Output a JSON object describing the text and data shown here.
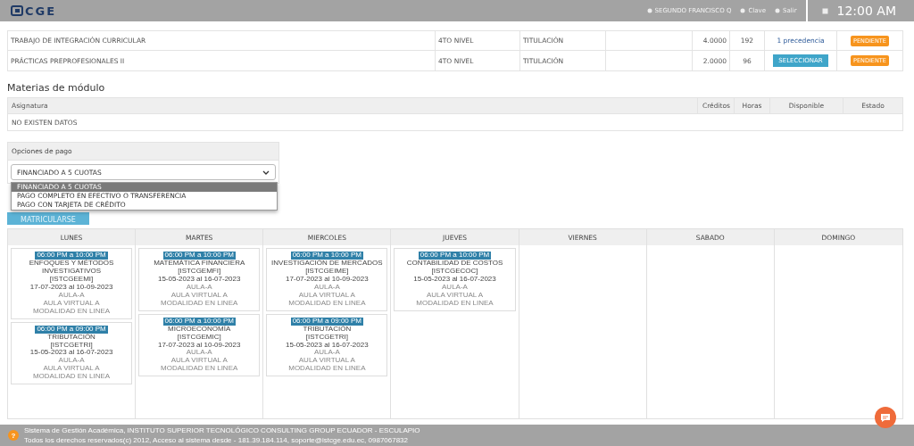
{
  "header": {
    "logo": "CGE",
    "user": "SEGUNDO FRANCISCO Q",
    "links": [
      "Clave",
      "Salir"
    ],
    "time": "12:00 AM"
  },
  "subjects": [
    {
      "name": "TRABAJO DE INTEGRACIÓN CURRICULAR",
      "level": "4TO NIVEL",
      "type": "TITULACIÓN",
      "credits": "4.0000",
      "hours": "192",
      "available": {
        "kind": "text",
        "label": "1 precedencia"
      },
      "status": "PENDIENTE"
    },
    {
      "name": "PRÁCTICAS PREPROFESIONALES II",
      "level": "4TO NIVEL",
      "type": "TITULACIÓN",
      "credits": "2.0000",
      "hours": "96",
      "available": {
        "kind": "button",
        "label": "SELECCIONAR"
      },
      "status": "PENDIENTE"
    }
  ],
  "module": {
    "title": "Materias de módulo",
    "columns": [
      "Asignatura",
      "Créditos",
      "Horas",
      "Disponible",
      "Estado"
    ],
    "empty": "NO EXISTEN DATOS"
  },
  "payment": {
    "title": "Opciones de pago",
    "value": "FINANCIADO A 5 CUOTAS",
    "options": [
      {
        "label": "FINANCIADO A 5 CUOTAS",
        "selected": true
      },
      {
        "label": "PAGO COMPLETO EN EFECTIVO O TRANSFERENCIA",
        "selected": false
      },
      {
        "label": "PAGO CON TARJETA DE CRÉDITO",
        "selected": false
      }
    ],
    "button": "MATRICULARSE"
  },
  "schedule": [
    {
      "day": "LUNES",
      "classes": [
        {
          "time": "06:00 PM a 10:00 PM",
          "name": "ENFOQUES Y MÉTODOS INVESTIGATIVOS",
          "code": "[ISTCGEEMI]",
          "dates": "17-07-2023 al 10-09-2023",
          "room": "AULA-A",
          "virtual": "AULA VIRTUAL A",
          "mode": "MODALIDAD EN LINEA"
        },
        {
          "time": "06:00 PM a 09:00 PM",
          "name": "TRIBUTACIÓN",
          "code": "[ISTCGETRI]",
          "dates": "15-05-2023 al 16-07-2023",
          "room": "AULA-A",
          "virtual": "AULA VIRTUAL A",
          "mode": "MODALIDAD EN LINEA"
        }
      ]
    },
    {
      "day": "MARTES",
      "classes": [
        {
          "time": "06:00 PM a 10:00 PM",
          "name": "MATEMÁTICA FINANCIERA",
          "code": "[ISTCGEMFI]",
          "dates": "15-05-2023 al 16-07-2023",
          "room": "AULA-A",
          "virtual": "AULA VIRTUAL A",
          "mode": "MODALIDAD EN LINEA"
        },
        {
          "time": "06:00 PM a 10:00 PM",
          "name": "MICROECONOMÍA",
          "code": "[ISTCGEMIC]",
          "dates": "17-07-2023 al 10-09-2023",
          "room": "AULA-A",
          "virtual": "AULA VIRTUAL A",
          "mode": "MODALIDAD EN LINEA"
        }
      ]
    },
    {
      "day": "MIERCOLES",
      "classes": [
        {
          "time": "06:00 PM a 10:00 PM",
          "name": "INVESTIGACIÓN DE MERCADOS",
          "code": "[ISTCGEIME]",
          "dates": "17-07-2023 al 10-09-2023",
          "room": "AULA-A",
          "virtual": "AULA VIRTUAL A",
          "mode": "MODALIDAD EN LINEA"
        },
        {
          "time": "06:00 PM a 09:00 PM",
          "name": "TRIBUTACIÓN",
          "code": "[ISTCGETRI]",
          "dates": "15-05-2023 al 16-07-2023",
          "room": "AULA-A",
          "virtual": "AULA VIRTUAL A",
          "mode": "MODALIDAD EN LINEA"
        }
      ]
    },
    {
      "day": "JUEVES",
      "classes": [
        {
          "time": "06:00 PM a 10:00 PM",
          "name": "CONTABILIDAD DE COSTOS",
          "code": "[ISTCGECOC]",
          "dates": "15-05-2023 al 16-07-2023",
          "room": "AULA-A",
          "virtual": "AULA VIRTUAL A",
          "mode": "MODALIDAD EN LINEA"
        }
      ]
    },
    {
      "day": "VIERNES"
    },
    {
      "day": "SABADO"
    },
    {
      "day": "DOMINGO"
    }
  ],
  "footer": {
    "help": "?",
    "lines": [
      "Sistema de Gestión Académica, INSTITUTO SUPERIOR TECNOLÓGICO CONSULTING GROUP ECUADOR - ESCULAPIO",
      "Todos los derechos reservados(c) 2012, Acceso al sistema desde - 181.39.184.114, soporte@istcge.edu.ec, 0987067832"
    ]
  }
}
